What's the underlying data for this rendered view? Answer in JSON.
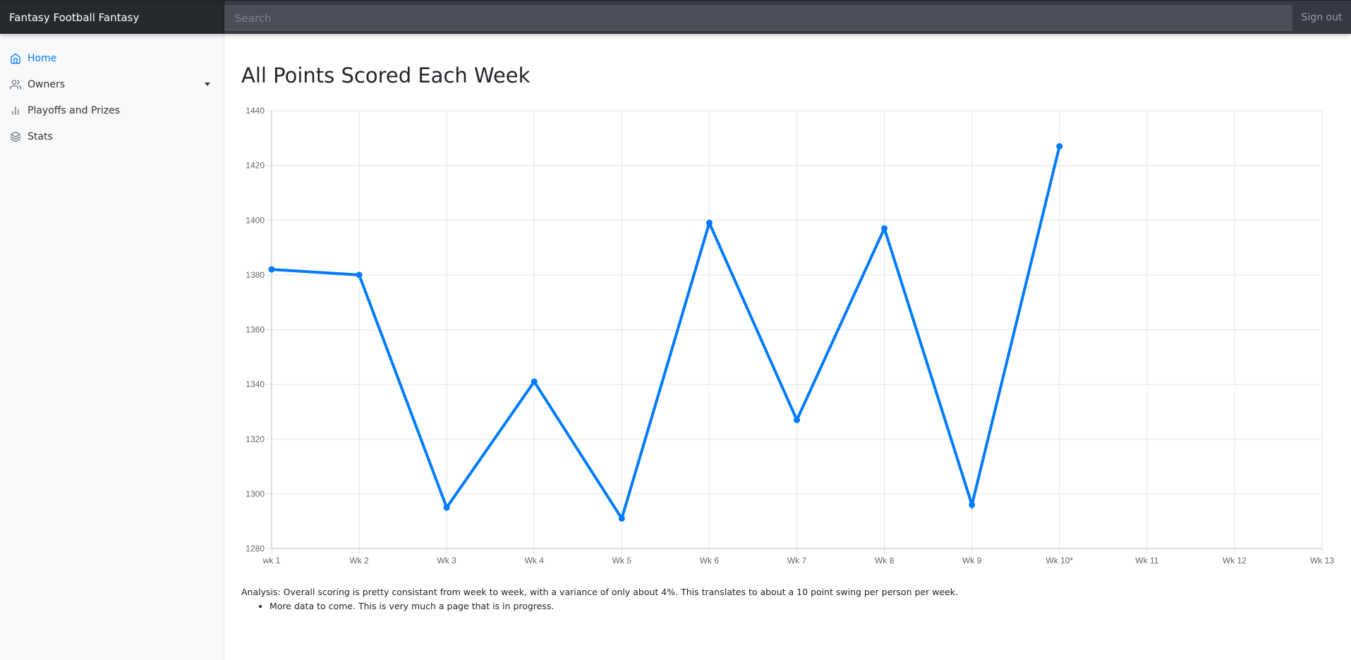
{
  "app": {
    "brand": "Fantasy Football Fantasy",
    "search_placeholder": "Search",
    "signout_label": "Sign out"
  },
  "sidebar": {
    "items": [
      {
        "label": "Home",
        "icon": "home-icon",
        "active": true
      },
      {
        "label": "Owners",
        "icon": "users-icon",
        "has_dropdown": true
      },
      {
        "label": "Playoffs and Prizes",
        "icon": "bar-chart-icon"
      },
      {
        "label": "Stats",
        "icon": "layers-icon"
      }
    ]
  },
  "main": {
    "title": "All Points Scored Each Week",
    "analysis": "Analysis: Overall scoring is pretty consistant from week to week, with a variance of only about 4%. This translates to about a 10 point swing per person per week.",
    "bullets": [
      "More data to come. This is very much a page that is in progress."
    ]
  },
  "colors": {
    "accent": "#007bff",
    "line": "#007bff"
  },
  "chart_data": {
    "type": "line",
    "categories": [
      "wk 1",
      "Wk 2",
      "Wk 3",
      "Wk 4",
      "Wk 5",
      "Wk 6",
      "Wk 7",
      "Wk 8",
      "Wk 9",
      "Wk 10*",
      "Wk 11",
      "Wk 12",
      "Wk 13"
    ],
    "values": [
      1382,
      1380,
      1295,
      1341,
      1291,
      1399,
      1327,
      1397,
      1296,
      1427,
      null,
      null,
      null
    ],
    "ylim": [
      1280,
      1440
    ],
    "yticks": [
      1280,
      1300,
      1320,
      1340,
      1360,
      1380,
      1400,
      1420,
      1440
    ],
    "grid": true,
    "legend": "none"
  }
}
